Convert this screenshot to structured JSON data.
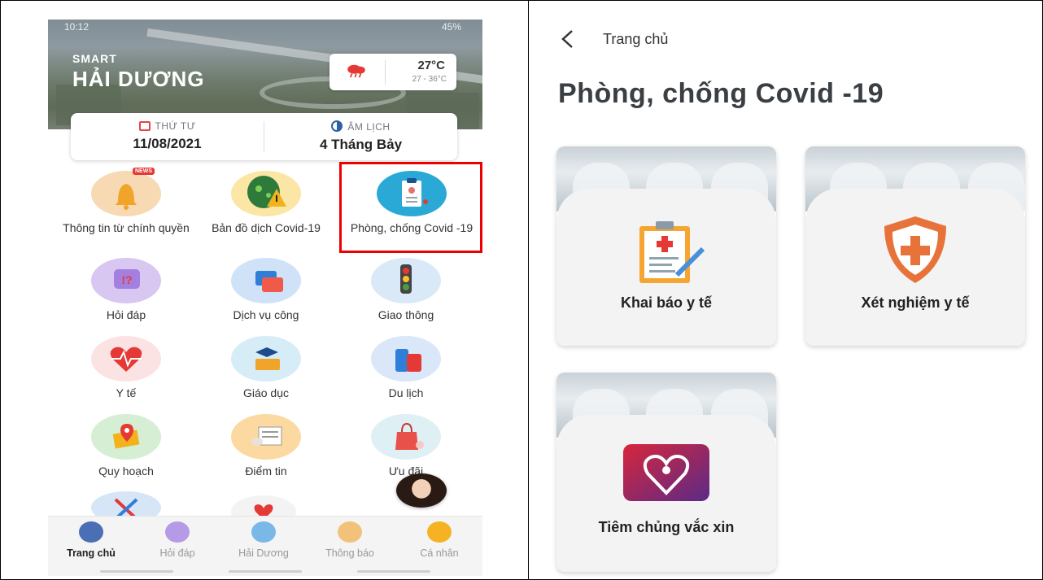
{
  "left": {
    "status_time": "10:12",
    "status_right": "45%",
    "brand_small": "SMART",
    "brand_city": "HẢI DƯƠNG",
    "weather": {
      "temp": "27°C",
      "range": "27 - 36°C"
    },
    "date": {
      "weekday_label": "THỨ TƯ",
      "solar": "11/08/2021",
      "lunar_label": "ÂM LỊCH",
      "lunar": "4 Tháng Bảy"
    },
    "news_badge": "NEWS",
    "grid": [
      {
        "label": "Thông tin từ chính quyền",
        "icon": "bell-icon",
        "color": "#f7d9b3"
      },
      {
        "label": "Bản đồ dịch Covid-19",
        "icon": "virus-map-icon",
        "color": "#fbe6a6"
      },
      {
        "label": "Phòng, chống Covid -19",
        "icon": "clipboard-icon",
        "color": "#2aa9d6"
      },
      {
        "label": "Hỏi đáp",
        "icon": "question-chat-icon",
        "color": "#d8c7f0"
      },
      {
        "label": "Dịch vụ công",
        "icon": "service-cards-icon",
        "color": "#cfe2f7"
      },
      {
        "label": "Giao thông",
        "icon": "traffic-light-icon",
        "color": "#d9e9f7"
      },
      {
        "label": "Y tế",
        "icon": "heartbeat-icon",
        "color": "#fbe3e3"
      },
      {
        "label": "Giáo dục",
        "icon": "graduation-icon",
        "color": "#d6edf7"
      },
      {
        "label": "Du lịch",
        "icon": "luggage-icon",
        "color": "#d9e7f8"
      },
      {
        "label": "Quy hoạch",
        "icon": "map-pin-icon",
        "color": "#d6eed3"
      },
      {
        "label": "Điểm tin",
        "icon": "newspaper-icon",
        "color": "#fbd9a0"
      },
      {
        "label": "Ưu đãi",
        "icon": "shopping-bag-icon",
        "color": "#dff0f5"
      }
    ],
    "tabs": [
      {
        "label": "Trang chủ",
        "icon": "home-icon",
        "color": "#4a6fb5",
        "active": true
      },
      {
        "label": "Hỏi đáp",
        "icon": "question-chat-icon",
        "color": "#b59be6",
        "active": false
      },
      {
        "label": "Hải Dương",
        "icon": "city-map-icon",
        "color": "#7ab8e8",
        "active": false
      },
      {
        "label": "Thông báo",
        "icon": "bell-icon",
        "color": "#f2c27a",
        "active": false
      },
      {
        "label": "Cá nhân",
        "icon": "person-icon",
        "color": "#f5b323",
        "active": false
      }
    ]
  },
  "right": {
    "breadcrumb": "Trang chủ",
    "title": "Phòng, chống Covid -19",
    "cards": [
      {
        "label": "Khai báo y tế",
        "icon": "medical-clipboard-icon"
      },
      {
        "label": "Xét nghiệm y tế",
        "icon": "medical-shield-icon"
      },
      {
        "label": "Tiêm chủng vắc xin",
        "icon": "vaccine-heart-icon"
      }
    ]
  }
}
